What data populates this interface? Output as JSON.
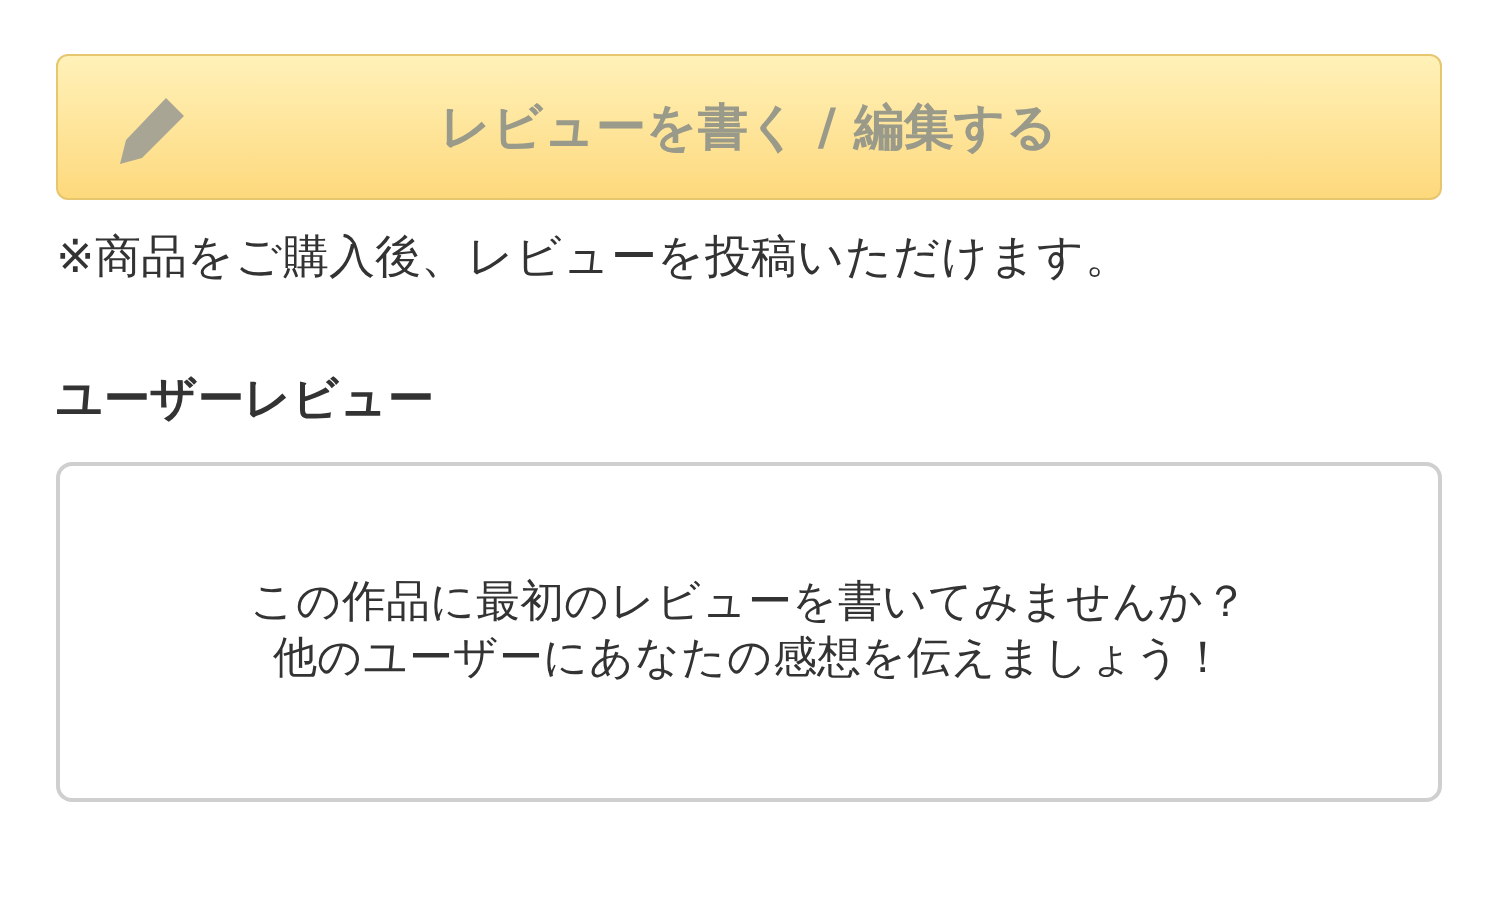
{
  "write_button": {
    "label": "レビューを書く / 編集する",
    "disabled": true
  },
  "note": "※商品をご購入後、レビューを投稿いただけます。",
  "reviews": {
    "heading": "ユーザーレビュー",
    "empty_message": [
      "この作品に最初のレビューを書いてみませんか？",
      "他のユーザーにあなたの感想を伝えましょう！"
    ]
  }
}
